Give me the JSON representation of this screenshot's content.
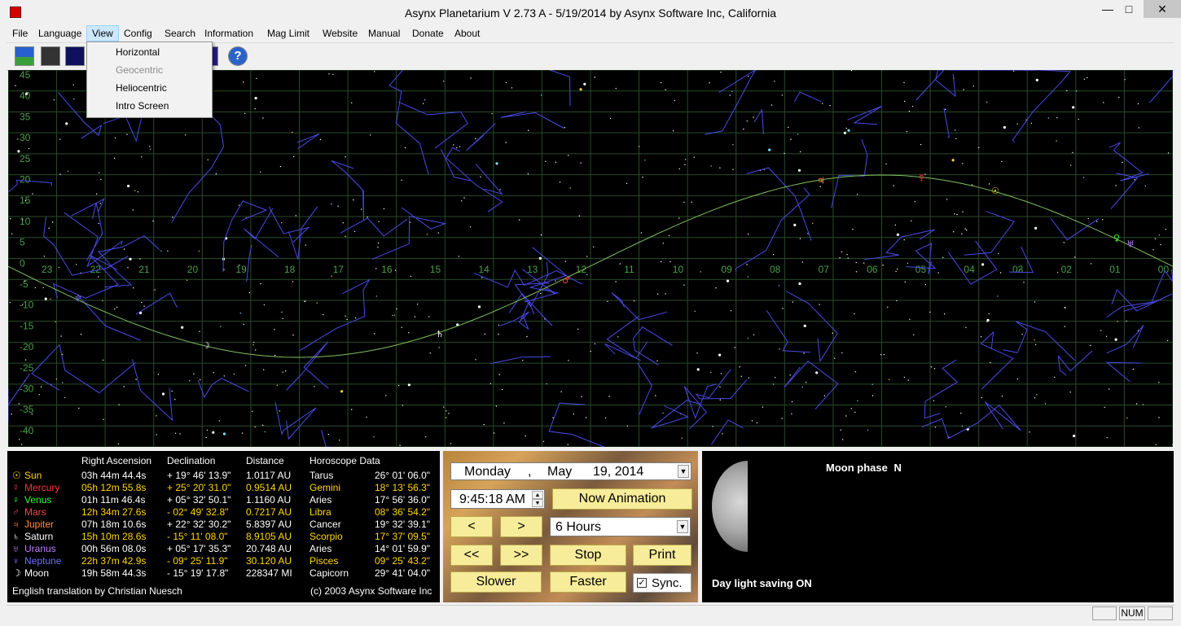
{
  "window": {
    "title": "Asynx Planetarium V 2.73 A - 5/19/2014 by Asynx Software Inc, California",
    "minimize": "—",
    "maximize": "□",
    "close": "✕"
  },
  "menu": {
    "items": [
      "File",
      "Language",
      "View",
      "Config",
      "Search",
      "Information",
      "Mag Limit",
      "Website",
      "Manual",
      "Donate",
      "About"
    ],
    "active": "View"
  },
  "view_menu": {
    "items": [
      {
        "label": "Horizontal",
        "enabled": true
      },
      {
        "label": "Geocentric",
        "enabled": false
      },
      {
        "label": "Heliocentric",
        "enabled": true
      },
      {
        "label": "Intro Screen",
        "enabled": true
      }
    ]
  },
  "toolbar": {
    "help_icon": "?"
  },
  "sky": {
    "dec_labels": [
      "45",
      "40",
      "35",
      "30",
      "25",
      "20",
      "15",
      "10",
      "5",
      "0",
      "-5",
      "-10",
      "-15",
      "-20",
      "-25",
      "-30",
      "-35",
      "-40"
    ],
    "ra_labels": [
      "23",
      "22",
      "21",
      "20",
      "19",
      "18",
      "17",
      "16",
      "15",
      "14",
      "13",
      "12",
      "11",
      "10",
      "09",
      "08",
      "07",
      "06",
      "05",
      "04",
      "03",
      "02",
      "01",
      "00"
    ],
    "colors": {
      "grid": "#2a4a2a",
      "ecliptic": "#7fbf5f",
      "constellation": "#4a4ae8",
      "labels": "#48a048"
    }
  },
  "planet_table": {
    "headers": {
      "ra": "Right Ascension",
      "dec": "Declination",
      "dist": "Distance",
      "horo": "Horoscope Data"
    },
    "rows": [
      {
        "symbol": "☉",
        "name": "Sun",
        "ra": "03h 44m 44.4s",
        "dec": "+ 19° 46' 13.9\"",
        "dist": "1.0117 AU",
        "sign": "Tarus",
        "deg": "26° 01' 06.0\"",
        "color": "#ffd700",
        "value_color": "#ffffff"
      },
      {
        "symbol": "☿",
        "name": "Mercury",
        "ra": "05h 12m 55.8s",
        "dec": "+ 25° 20' 31.0\"",
        "dist": "0.9514 AU",
        "sign": "Gemini",
        "deg": "18° 13' 56.3\"",
        "color": "#ff3030",
        "value_color": "#ffd700"
      },
      {
        "symbol": "♀",
        "name": "Venus",
        "ra": "01h 11m 46.4s",
        "dec": "+ 05° 32' 50.1\"",
        "dist": "1.1160 AU",
        "sign": "Aries",
        "deg": "17° 56' 36.0\"",
        "color": "#30ff30",
        "value_color": "#ffffff"
      },
      {
        "symbol": "♂",
        "name": "Mars",
        "ra": "12h 34m 27.6s",
        "dec": "- 02° 49' 32.8\"",
        "dist": "0.7217 AU",
        "sign": "Libra",
        "deg": "08° 36' 54.2\"",
        "color": "#ff4040",
        "value_color": "#ffd700"
      },
      {
        "symbol": "♃",
        "name": "Jupiter",
        "ra": "07h 18m 10.6s",
        "dec": "+ 22° 32' 30.2\"",
        "dist": "5.8397 AU",
        "sign": "Cancer",
        "deg": "19° 32' 39.1\"",
        "color": "#ff8c40",
        "value_color": "#ffffff"
      },
      {
        "symbol": "♄",
        "name": "Saturn",
        "ra": "15h 10m 28.6s",
        "dec": "- 15° 11' 08.0\"",
        "dist": "8.9105 AU",
        "sign": "Scorpio",
        "deg": "17° 37' 09.5\"",
        "color": "#ffffff",
        "value_color": "#ffd700"
      },
      {
        "symbol": "♅",
        "name": "Uranus",
        "ra": "00h 56m 08.0s",
        "dec": "+ 05° 17' 35.3\"",
        "dist": "20.748 AU",
        "sign": "Aries",
        "deg": "14° 01' 59.9\"",
        "color": "#c07cff",
        "value_color": "#ffffff"
      },
      {
        "symbol": "♆",
        "name": "Neptune",
        "ra": "22h 37m 42.9s",
        "dec": "- 09° 25' 11.9\"",
        "dist": "30.120 AU",
        "sign": "Pisces",
        "deg": "09° 25' 43.2\"",
        "color": "#6f6fff",
        "value_color": "#ffd700"
      },
      {
        "symbol": "☽",
        "name": "Moon",
        "ra": "19h 58m 44.3s",
        "dec": "- 15° 19' 17.8\"",
        "dist": "228347 MI",
        "sign": "Capicorn",
        "deg": "29° 41' 04.0\"",
        "color": "#ffffff",
        "value_color": "#ffffff"
      }
    ],
    "footer_left": "English translation by Christian Nuesch",
    "footer_right": "(c) 2003 Asynx Software Inc"
  },
  "controls": {
    "date_weekday": "Monday",
    "date_sep": ",",
    "date_month": "May",
    "date_day_year": "19, 2014",
    "time": "9:45:18 AM",
    "now_animation": "Now Animation",
    "back": "<",
    "forward": ">",
    "step": "6 Hours",
    "fast_back": "<<",
    "fast_forward": ">>",
    "stop": "Stop",
    "print": "Print",
    "slower": "Slower",
    "faster": "Faster",
    "sync": "Sync.",
    "sync_checked": true
  },
  "moon": {
    "phase_label": "Moon phase",
    "phase_value": "N",
    "dst_status": "Day light saving ON"
  },
  "statusbar": {
    "num": "NUM"
  }
}
